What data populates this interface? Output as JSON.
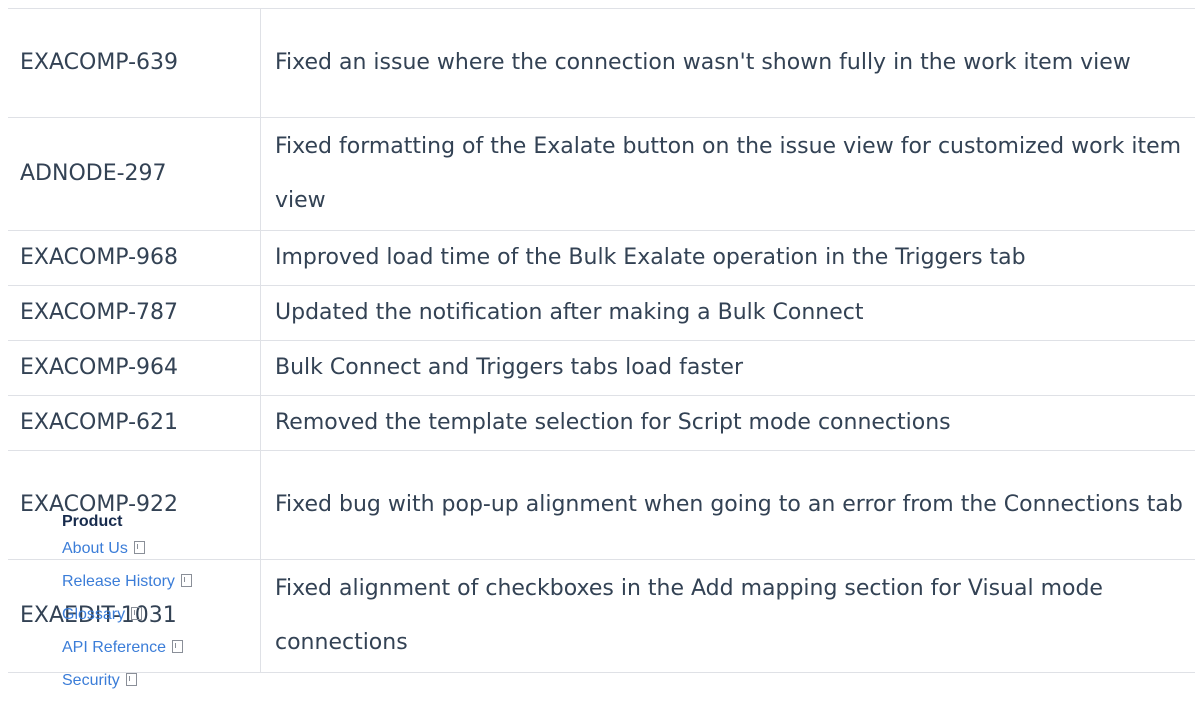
{
  "rows": [
    {
      "key": "EXACOMP-639",
      "description": "Fixed an issue where the connection wasn't shown fully in the work item view"
    },
    {
      "key": "ADNODE-297",
      "description": "Fixed formatting of the Exalate button on the issue view for customized work item view"
    },
    {
      "key": "EXACOMP-968",
      "description": "Improved load time of the Bulk Exalate operation in the Triggers tab"
    },
    {
      "key": "EXACOMP-787",
      "description": "Updated the notification after making a Bulk Connect"
    },
    {
      "key": "EXACOMP-964",
      "description": "Bulk Connect and Triggers tabs load faster"
    },
    {
      "key": "EXACOMP-621",
      "description": "Removed the template selection for Script mode connections"
    },
    {
      "key": "EXACOMP-922",
      "description": "Fixed bug with pop-up alignment when going to an error from the Connections tab"
    },
    {
      "key": "EXAEDIT-1031",
      "description": "Fixed alignment of checkboxes in the Add mapping section for Visual mode connections"
    }
  ],
  "footer": {
    "heading": "Product",
    "links": [
      {
        "label": "About Us",
        "icon": "external-link-icon"
      },
      {
        "label": "Release History",
        "icon": "external-link-icon"
      },
      {
        "label": "Glossary",
        "icon": "external-link-icon"
      },
      {
        "label": "API Reference",
        "icon": "external-link-icon"
      },
      {
        "label": "Security",
        "icon": "external-link-icon"
      }
    ]
  }
}
